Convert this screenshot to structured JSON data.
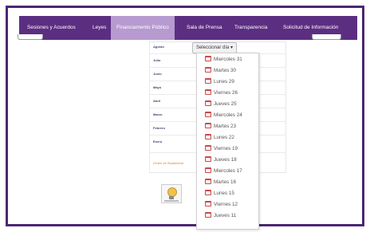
{
  "nav": {
    "items": [
      {
        "label": "Sesiones y Acuerdos"
      },
      {
        "label": "Leyes"
      },
      {
        "label": "Financiamento Público"
      },
      {
        "label": "Sala de Prensa"
      },
      {
        "label": "Transparencia"
      },
      {
        "label": "Solicitud de Información"
      }
    ],
    "active_index": 2
  },
  "months": [
    "Agosto",
    "Julio",
    "Junio",
    "Mayo",
    "Abril",
    "Marzo",
    "Febrero",
    "Enero"
  ],
  "orden_link": "Orden de Septiembre",
  "select": {
    "label": "Seleccionar día ▾"
  },
  "dropdown": {
    "items": [
      "Miercoles 31",
      "Martes 30",
      "Lunes 29",
      "Viernes 26",
      "Jueves 25",
      "Miercoles 24",
      "Martes 23",
      "Lunes 22",
      "Viernes 19",
      "Jueves 18",
      "Miercoles 17",
      "Martes 16",
      "Lunes 15",
      "Viernes 12",
      "Jueves 11"
    ],
    "item_icon": "calendar-icon"
  },
  "icons": {
    "document": "lightbulb-document-icon"
  },
  "colors": {
    "nav_bg": "#5b2e82",
    "nav_active": "#b79ad0",
    "frame": "#4b2773",
    "link": "#e07a2a"
  }
}
